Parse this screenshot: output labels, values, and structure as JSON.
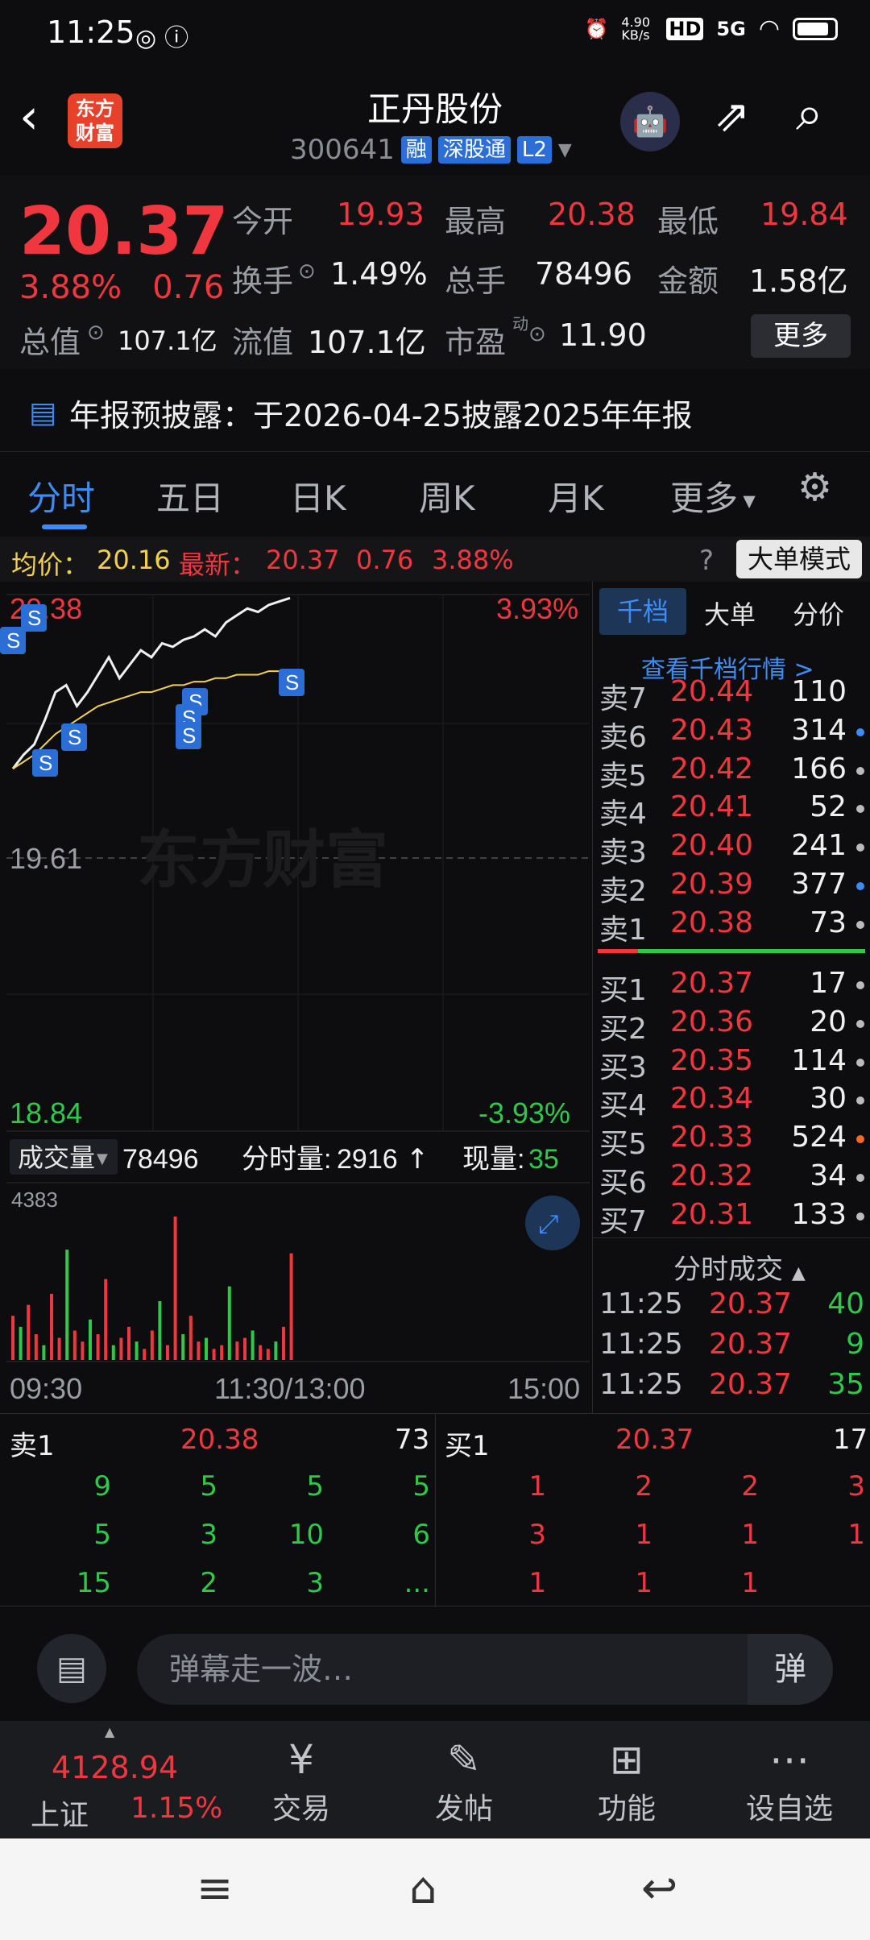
{
  "status_bar": {
    "time": "11:25",
    "net_speed": "4.90 KB/s",
    "hd": "HD",
    "signal": "5G"
  },
  "header": {
    "logo_text": "东方财富",
    "stock_name": "正丹股份",
    "stock_code": "300641",
    "tags": [
      "融",
      "深股通",
      "L2"
    ]
  },
  "quote": {
    "price": "20.37",
    "change_pct": "3.88%",
    "change_amt": "0.76",
    "fields": [
      {
        "label": "今开",
        "value": "19.93"
      },
      {
        "label": "最高",
        "value": "20.38"
      },
      {
        "label": "最低",
        "value": "19.84"
      },
      {
        "label": "换手",
        "value": "1.49%"
      },
      {
        "label": "总手",
        "value": "78496"
      },
      {
        "label": "金额",
        "value": "1.58亿"
      },
      {
        "label": "总值",
        "value": "107.1亿"
      },
      {
        "label": "流值",
        "value": "107.1亿"
      },
      {
        "label": "市盈",
        "value": "11.90"
      }
    ],
    "pe_sup": "动",
    "more_label": "更多"
  },
  "notice": {
    "text": "年报预披露：于2026-04-25披露2025年年报"
  },
  "tabs": [
    "分时",
    "五日",
    "日K",
    "周K",
    "月K",
    "更多"
  ],
  "info_line": {
    "avg_label": "均价：",
    "avg_value": "20.16",
    "latest_label": "最新：",
    "latest_value": "20.37",
    "chg": "0.76",
    "pct": "3.88%",
    "mode_label": "大单模式"
  },
  "chart": {
    "high_price": "20.38",
    "high_pct": "3.93%",
    "mid_price": "19.61",
    "low_price": "18.84",
    "low_pct": "-3.93%",
    "watermark": "东方财富",
    "volume_label": "成交量",
    "volume_total": "78496",
    "minute_vol_label": "分时量:",
    "minute_vol": "2916",
    "current_vol_label": "现量:",
    "current_vol": "35",
    "vol_max": "4383",
    "time_start": "09:30",
    "time_mid": "11:30/13:00",
    "time_end": "15:00"
  },
  "chart_data": {
    "type": "line",
    "ylim": [
      18.84,
      20.38
    ],
    "series": [
      {
        "values": [
          19.88,
          19.92,
          19.95,
          20.02,
          20.1,
          20.12,
          20.06,
          20.1,
          20.15,
          20.2,
          20.14,
          20.18,
          20.22,
          20.2,
          20.24,
          20.23,
          20.25,
          20.26,
          20.28,
          20.26,
          20.3,
          20.32,
          20.34,
          20.33,
          20.35,
          20.36,
          20.37
        ]
      },
      {
        "values": [
          19.88,
          19.9,
          19.92,
          19.95,
          19.98,
          20.0,
          20.02,
          20.04,
          20.06,
          20.07,
          20.08,
          20.09,
          20.1,
          20.1,
          20.11,
          20.12,
          20.12,
          20.13,
          20.13,
          20.14,
          20.14,
          20.15,
          20.15,
          20.15,
          20.16,
          20.16,
          20.16
        ]
      }
    ],
    "volumes": [
      1200,
      900,
      1500,
      700,
      400,
      1800,
      600,
      3000,
      800,
      500,
      1100,
      700,
      2200,
      400,
      600,
      900,
      500,
      300,
      800,
      1600,
      400,
      3900,
      700,
      1200,
      500,
      600,
      300,
      400,
      2000,
      500,
      600,
      800,
      400,
      300,
      500,
      900,
      2900
    ]
  },
  "order_book": {
    "tabs": [
      "千档",
      "大单",
      "分价"
    ],
    "link": "查看千档行情 >",
    "asks": [
      {
        "label": "卖7",
        "price": "20.44",
        "vol": "110",
        "dot": ""
      },
      {
        "label": "卖6",
        "price": "20.43",
        "vol": "314",
        "dot": "#3d8cf5"
      },
      {
        "label": "卖5",
        "price": "20.42",
        "vol": "166",
        "dot": "#bbbbbb"
      },
      {
        "label": "卖4",
        "price": "20.41",
        "vol": "52",
        "dot": "#bbbbbb"
      },
      {
        "label": "卖3",
        "price": "20.40",
        "vol": "241",
        "dot": "#bbbbbb"
      },
      {
        "label": "卖2",
        "price": "20.39",
        "vol": "377",
        "dot": "#3d8cf5"
      },
      {
        "label": "卖1",
        "price": "20.38",
        "vol": "73",
        "dot": "#bbbbbb"
      }
    ],
    "bids": [
      {
        "label": "买1",
        "price": "20.37",
        "vol": "17",
        "dot": "#bbbbbb"
      },
      {
        "label": "买2",
        "price": "20.36",
        "vol": "20",
        "dot": "#bbbbbb"
      },
      {
        "label": "买3",
        "price": "20.35",
        "vol": "114",
        "dot": "#bbbbbb"
      },
      {
        "label": "买4",
        "price": "20.34",
        "vol": "30",
        "dot": "#bbbbbb"
      },
      {
        "label": "买5",
        "price": "20.33",
        "vol": "524",
        "dot": "#f06a2a"
      },
      {
        "label": "买6",
        "price": "20.32",
        "vol": "34",
        "dot": "#bbbbbb"
      },
      {
        "label": "买7",
        "price": "20.31",
        "vol": "133",
        "dot": "#bbbbbb"
      }
    ],
    "ticks_title": "分时成交",
    "ticks": [
      {
        "time": "11:25",
        "price": "20.37",
        "vol": "40"
      },
      {
        "time": "11:25",
        "price": "20.37",
        "vol": "9"
      },
      {
        "time": "11:25",
        "price": "20.37",
        "vol": "35"
      }
    ]
  },
  "level2": {
    "sell": {
      "label": "卖1",
      "price": "20.38",
      "vol": "73",
      "rows": [
        [
          "9",
          "5",
          "5",
          "5"
        ],
        [
          "5",
          "3",
          "10",
          "6"
        ],
        [
          "15",
          "2",
          "3",
          "..."
        ]
      ]
    },
    "buy": {
      "label": "买1",
      "price": "20.37",
      "vol": "17",
      "rows": [
        [
          "1",
          "2",
          "2",
          "3"
        ],
        [
          "3",
          "1",
          "1",
          "1"
        ],
        [
          "1",
          "1",
          "1",
          ""
        ]
      ]
    }
  },
  "danmu": {
    "placeholder": "弹幕走一波…",
    "send_label": "弹"
  },
  "bottom_nav": {
    "index_value": "4128.94",
    "index_name": "上证",
    "index_pct": "1.15%",
    "items": [
      "交易",
      "发帖",
      "功能",
      "设自选"
    ]
  }
}
